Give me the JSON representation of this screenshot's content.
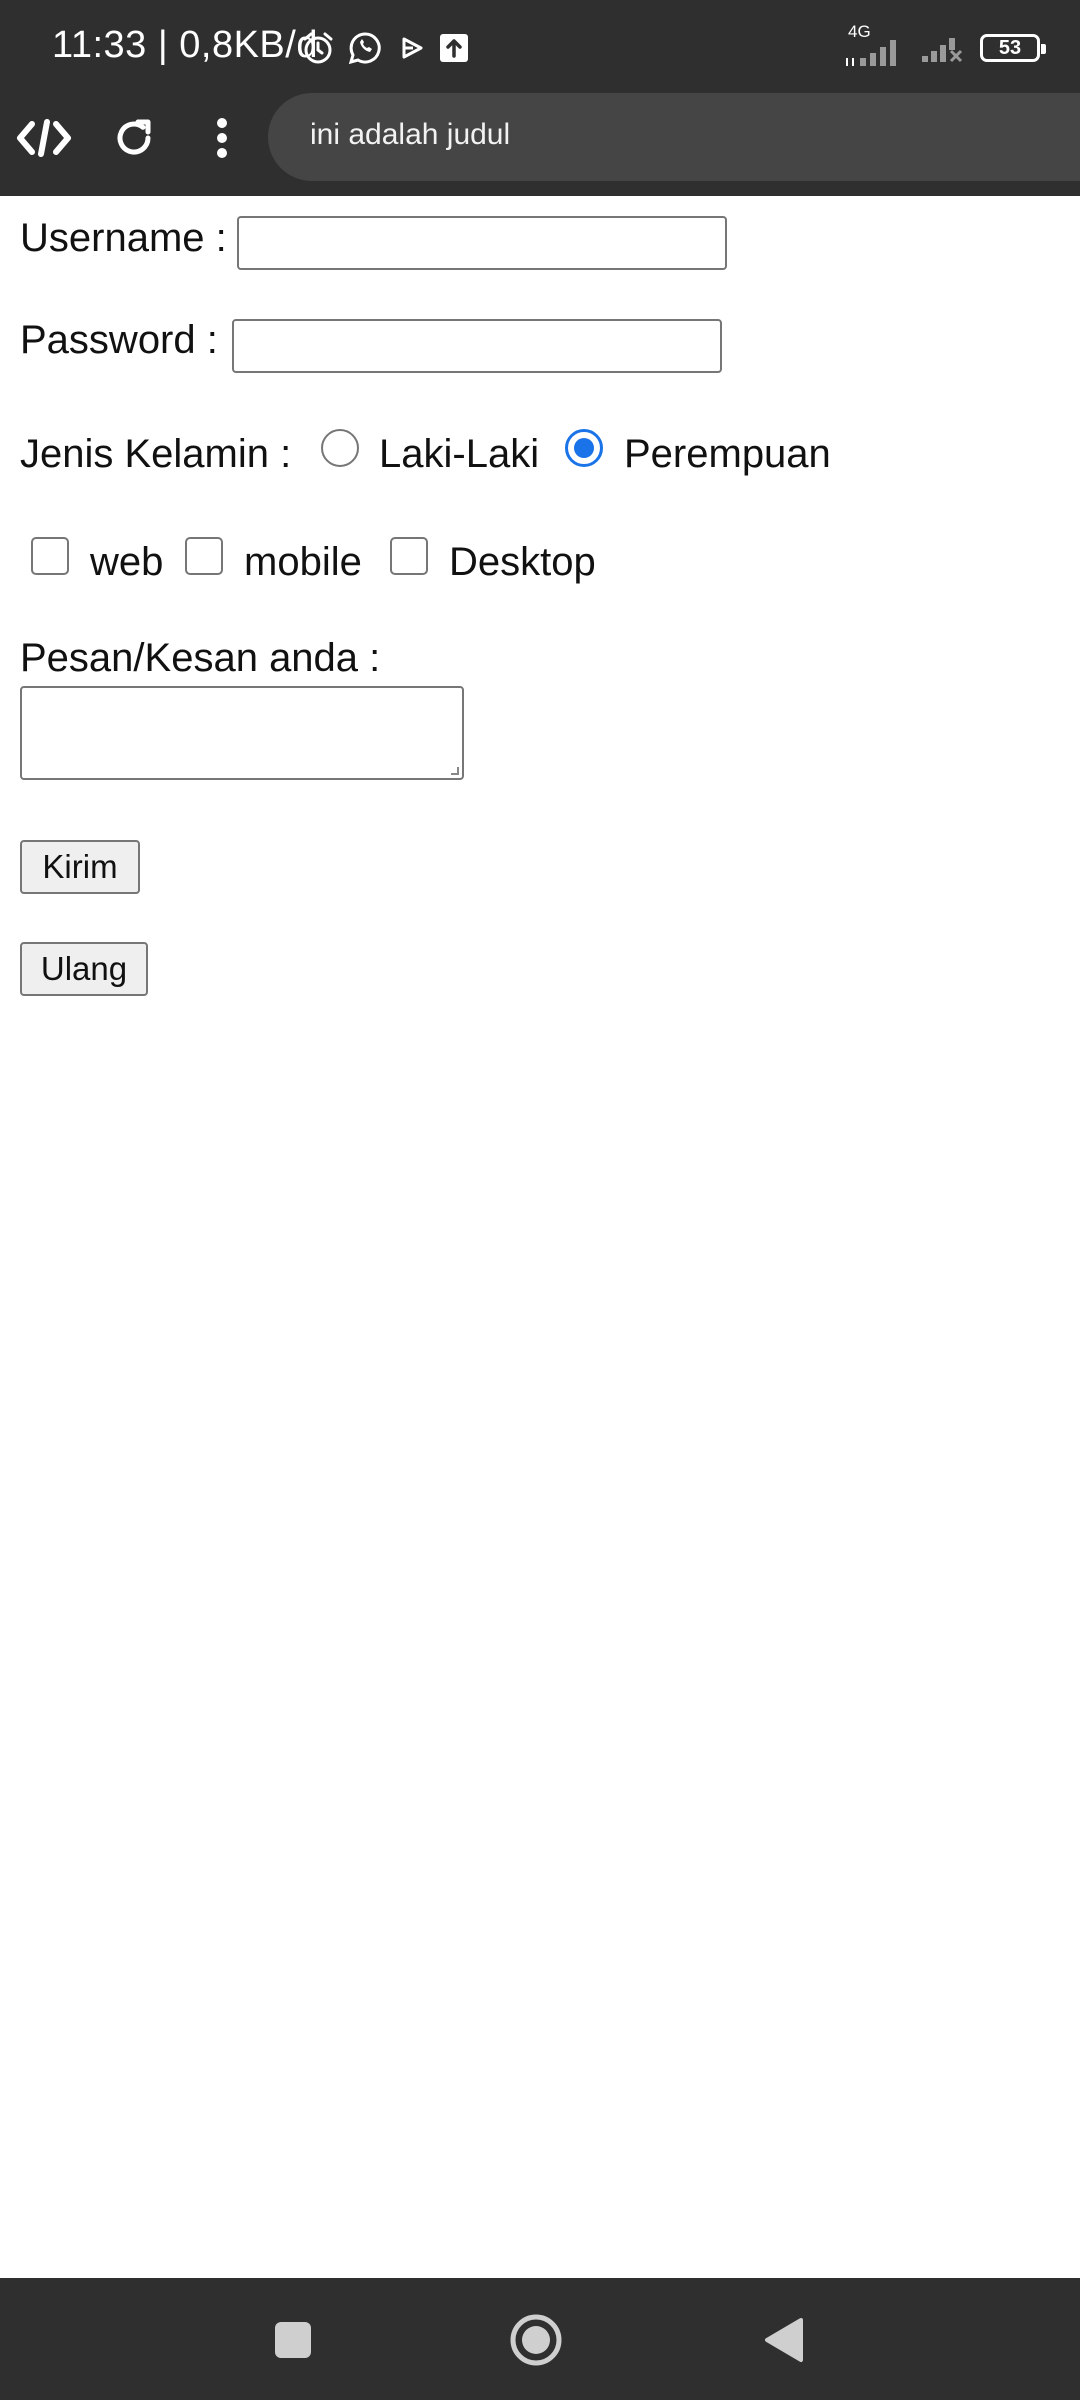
{
  "status_bar": {
    "time_net": "11:33 | 0,8KB/d",
    "network": "4G",
    "battery": "53",
    "icons": [
      "alarm-icon",
      "whatsapp-icon",
      "play-icon",
      "upload-icon",
      "signal-icon",
      "signal-off-icon",
      "battery-icon"
    ]
  },
  "browser": {
    "url_text": "ini adalah judul",
    "icons": [
      "code-icon",
      "reload-icon",
      "more-icon"
    ]
  },
  "form": {
    "username_label": "Username :",
    "username_value": "",
    "password_label": "Password :",
    "password_value": "",
    "gender_label": "Jenis Kelamin :",
    "gender_options": [
      "Laki-Laki",
      "Perempuan"
    ],
    "gender_selected": "Perempuan",
    "interests": [
      {
        "label": "web",
        "checked": false
      },
      {
        "label": "mobile",
        "checked": false
      },
      {
        "label": "Desktop",
        "checked": false
      }
    ],
    "message_label": "Pesan/Kesan anda :",
    "message_value": "",
    "submit_label": "Kirim",
    "reset_label": "Ulang"
  },
  "nav_bar": {
    "icons": [
      "recent-apps-icon",
      "home-icon",
      "back-icon"
    ]
  },
  "colors": {
    "system_bar": "#2f2f2f",
    "url_bar": "#454545",
    "accent": "#1a73e8",
    "border": "#767676",
    "button_bg": "#efefef"
  }
}
